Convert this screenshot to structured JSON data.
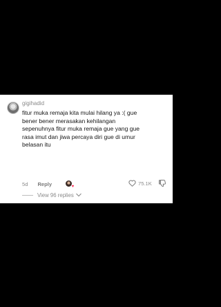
{
  "comment": {
    "username": "gigihadid",
    "lines": [
      "fitur muka remaja kita mulai hilang ya :( gue",
      "bener bener merasakan kehilangan",
      "sepenuhnya fitur muka remaja gue yang gue",
      "rasa imut dan jiwa percaya diri gue di umur",
      "belasan itu"
    ],
    "age": "5d",
    "reply_label": "Reply",
    "likes": "75.1K",
    "view_replies": "View 96 replies"
  },
  "icons": {
    "like": "heart-outline-icon",
    "dislike": "thumbs-down-icon",
    "expand": "chevron-down-icon",
    "creator_like": "creator-liked-avatar-icon"
  },
  "colors": {
    "background": "#000000",
    "card": "#ffffff",
    "text": "#161616",
    "muted": "#8a8a8a",
    "accent": "#fe2c55"
  }
}
